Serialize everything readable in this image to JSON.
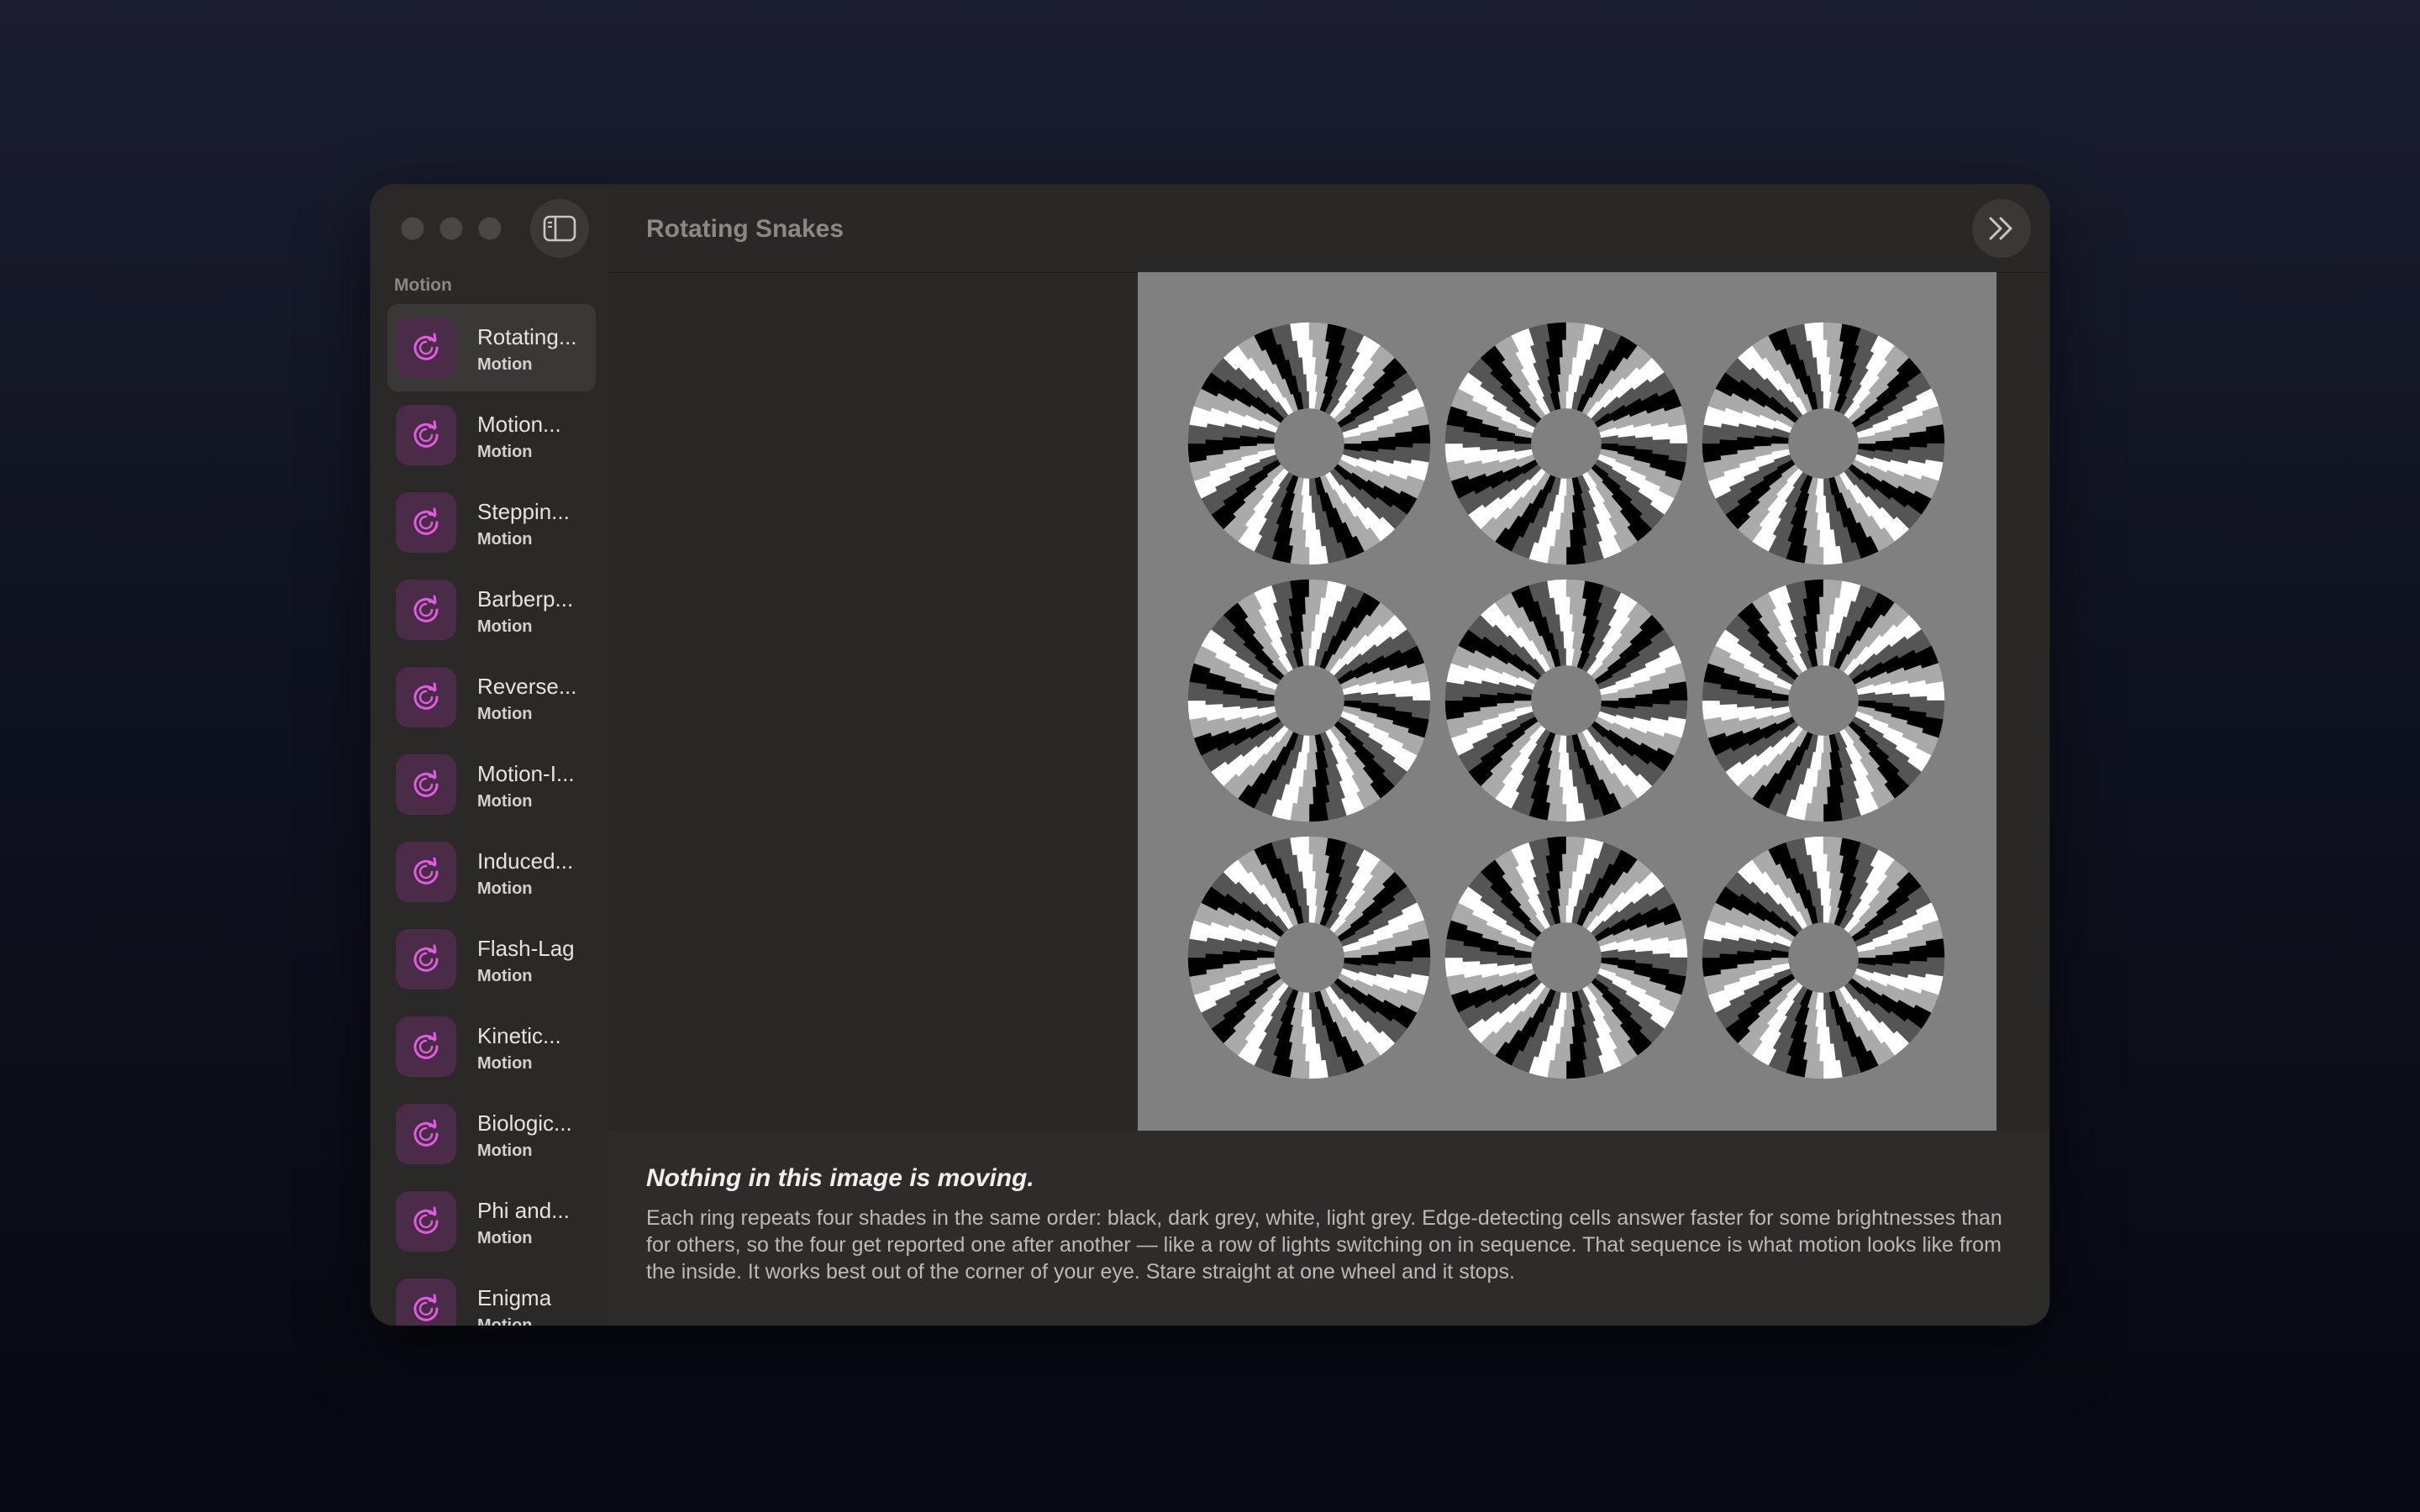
{
  "window": {
    "title": "Rotating Snakes"
  },
  "sidebar": {
    "section": "Motion",
    "items": [
      {
        "title": "Rotating...",
        "subtitle": "Motion",
        "selected": true
      },
      {
        "title": "Motion...",
        "subtitle": "Motion"
      },
      {
        "title": "Steppin...",
        "subtitle": "Motion"
      },
      {
        "title": "Barberp...",
        "subtitle": "Motion"
      },
      {
        "title": "Reverse...",
        "subtitle": "Motion"
      },
      {
        "title": "Motion-I...",
        "subtitle": "Motion"
      },
      {
        "title": "Induced...",
        "subtitle": "Motion"
      },
      {
        "title": "Flash-Lag",
        "subtitle": "Motion"
      },
      {
        "title": "Kinetic...",
        "subtitle": "Motion"
      },
      {
        "title": "Biologic...",
        "subtitle": "Motion"
      },
      {
        "title": "Phi and...",
        "subtitle": "Motion"
      },
      {
        "title": "Enigma",
        "subtitle": "Motion"
      }
    ],
    "icon": "rotate-arrow-icon",
    "accent": "#e05ce0"
  },
  "illusion": {
    "grid": [
      3,
      3
    ],
    "shades": [
      "#000000",
      "#555555",
      "#ffffff",
      "#aaaaaa"
    ],
    "background": "#808080"
  },
  "caption": {
    "headline": "Nothing in this image is moving.",
    "body": "Each ring repeats four shades in the same order: black, dark grey, white, light grey. Edge-detecting cells answer faster for some brightnesses than for others, so the four get reported one after another — like a row of lights switching on in sequence. That sequence is what motion looks like from the inside. It works best out of the corner of your eye. Stare straight at one wheel and it stops."
  }
}
